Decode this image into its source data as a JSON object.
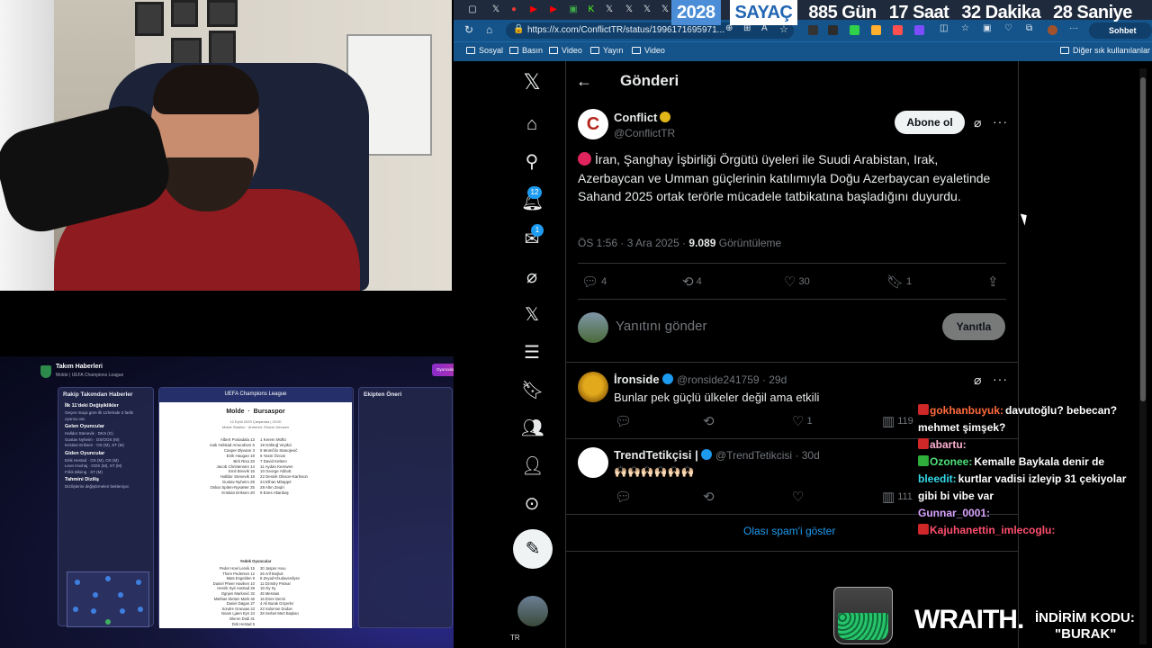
{
  "countdown": {
    "year": "2028",
    "label": "SAYAÇ",
    "days": "885 Gün",
    "hours": "17 Saat",
    "minutes": "32 Dakika",
    "seconds": "28 Saniye"
  },
  "browser": {
    "url": "https://x.com/ConflictTR/status/1996171695971...",
    "chat_button": "Sohbet et",
    "bookmarks": [
      "Sosyal",
      "Basın",
      "Yayın",
      "Video",
      "Video"
    ],
    "other_bookmarks": "Diğer sık kullanılanlar"
  },
  "x": {
    "notification_badge": "12",
    "messages_badge": "1",
    "header_title": "Gönderi",
    "post": {
      "display_name": "Conflict",
      "handle": "@ConflictTR",
      "follow_label": "Abone ol",
      "text": "İran, Şanghay İşbirliği Örgütü üyeleri ile Suudi Arabistan, Irak, Azerbaycan ve Umman güçlerinin katılımıyla Doğu Azerbaycan eyaletinde Sahand 2025 ortak terörle mücadele tatbikatına başladığını duyurdu.",
      "time": "ÖS 1:56 · 3 Ara 2025 ·",
      "views": "9.089",
      "views_label": "Görüntüleme",
      "replies": "4",
      "reposts": "4",
      "likes": "30",
      "bookmarks": "1"
    },
    "reply_box": {
      "placeholder": "Yanıtını gönder",
      "button": "Yanıtla"
    },
    "comments": [
      {
        "name": "İronside",
        "handle": "@ronside241759 · 29d",
        "text": "Bunlar pek güçlü ülkeler değil ama etkili",
        "likes": "1",
        "views": "119"
      },
      {
        "name": "TrendTetikçisi |",
        "handle": "@TrendTetikcisi · 30d",
        "text": "🙌🏻🙌🏻🙌🏻🙌🏻🙌🏻🙌🏻",
        "likes": "",
        "views": "111"
      }
    ],
    "show_spam": "Olası spam'i göster"
  },
  "stream_chat": [
    {
      "user": "gokhanbuyuk:",
      "message": "davutoğlu? bebecan? mehmet şimşek?",
      "color": "#ff6a3d",
      "badge": "#d02828"
    },
    {
      "user": "abartu:",
      "message": "",
      "color": "#ffb0d0",
      "badge": "#d02828"
    },
    {
      "user": "Ozonee:",
      "message": "Kemalle Baykala denir de",
      "color": "#4fe07a",
      "badge": "#2fae3c"
    },
    {
      "user": "bleedit:",
      "message": "kurtlar vadisi izleyip 31 çekiyolar gibi bi vibe var",
      "color": "#35d8e8",
      "badge": ""
    },
    {
      "user": "Gunnar_0001:",
      "message": "",
      "color": "#d9a3ff",
      "badge": ""
    },
    {
      "user": "Kajuhanettin_imlecoglu:",
      "message": "",
      "color": "#ff4f6d",
      "badge": "#d02828"
    }
  ],
  "promo": {
    "brand": "WRAITH.",
    "line1": "İNDİRİM KODU:",
    "line2": "\"BURAK\""
  },
  "fm": {
    "title": "Takım Haberleri",
    "subtitle": "Molde  |  UEFA Champions League",
    "cta": "Oyuncuları Güncelle",
    "panel_left_title": "Rakip Takımdan Haberler",
    "panel_left_sub": "İlk 11'deki Değişiklikler",
    "incoming": "Gelen Oyuncular",
    "outgoing": "Giden Oyuncular",
    "prediction": "Tahmini Diziliş",
    "competition": "UEFA Champions League",
    "home": "Molde",
    "away": "Bursaspor",
    "date": "12 Eylül 2029 Çarşamba | 20:00",
    "venue": "Molde Stadion · Antrenör: Erland Johnsen",
    "subs_title": "Yedek Oyuncular",
    "coach": "Ekibin Lider Koçu",
    "panel_right_title": "Ekipten Öneri",
    "lineup_home": [
      "Albert Posiadala 13",
      "Isak Helstad Amundsen 6",
      "Casper Øyvann 3",
      "Eirik Haugan 19",
      "Birk Risa 33",
      "Jacob Christensen 14",
      "Emil Breivik 16",
      "Halldor Stenevik 18",
      "Gustav Nyheim 29",
      "Oskar Spiten-Nysæter 25",
      "Kristian Eriksen 20"
    ],
    "lineup_away": [
      "1 Kerem Müftü",
      "19 Göktuğ Veyikci",
      "5 Momčilo Stanojević",
      "6 Yasin Özcan",
      "7 David Keltem",
      "11 Aydan Keerwen",
      "10 George Abbott",
      "22 Desnik Olsson-Karlsson",
      "24 Ethan Mbappé",
      "28 Altın Zeqiri",
      "9 Enes Altanbaş"
    ],
    "subs_home": [
      "Peder Hoel Lervik 15",
      "Thore Pedersen 12",
      "Mats Engelden 8",
      "Daniel Pheer Haviken 10",
      "Henrik Syé Aarstad 28",
      "Ognjen Marković 32",
      "Mathias Sletten Mørk 46",
      "Daniel Døgan 27",
      "Sondre Granaas 23",
      "Noam Ljøen Eyn 24",
      "Bleron Dodi 31",
      "Dirk Hestad 5"
    ],
    "subs_away": [
      "30 Jasper Axvu",
      "26 Arif Boşluk",
      "8 Zeyad Khudaverdiyev",
      "11 Dzmitry Pismar",
      "18 Aly Sy",
      "45 Messias",
      "16 Emre Demir",
      "4 Ali Burak Göçerler",
      "23 Solomon Dodan",
      "28 Serbet Mert Başkan"
    ]
  }
}
